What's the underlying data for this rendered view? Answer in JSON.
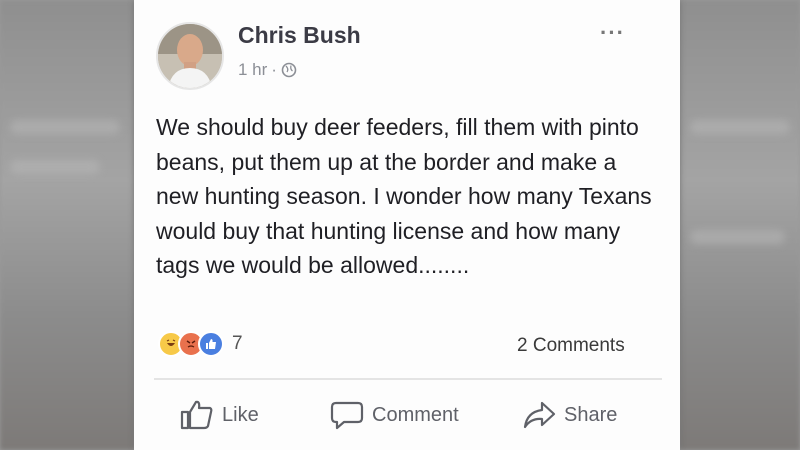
{
  "post": {
    "author": "Chris Bush",
    "timestamp": "1 hr",
    "separator": "·",
    "privacy_icon": "globe-icon",
    "more_label": "···",
    "text": "We should buy deer feeders, fill them with pinto beans, put them up at the border and make a new hunting season. I wonder how many Texans would buy that hunting license and how many tags we would be allowed........",
    "reactions": {
      "icons": [
        "haha-reaction-icon",
        "angry-reaction-icon",
        "like-reaction-icon"
      ],
      "count": "7"
    },
    "comments_label": "2 Comments"
  },
  "actions": {
    "like": "Like",
    "comment": "Comment",
    "share": "Share"
  },
  "colors": {
    "card": "#fdfdfd",
    "text": "#1f1f24",
    "muted": "#8c8f96",
    "like_blue": "#4a7fe0"
  }
}
